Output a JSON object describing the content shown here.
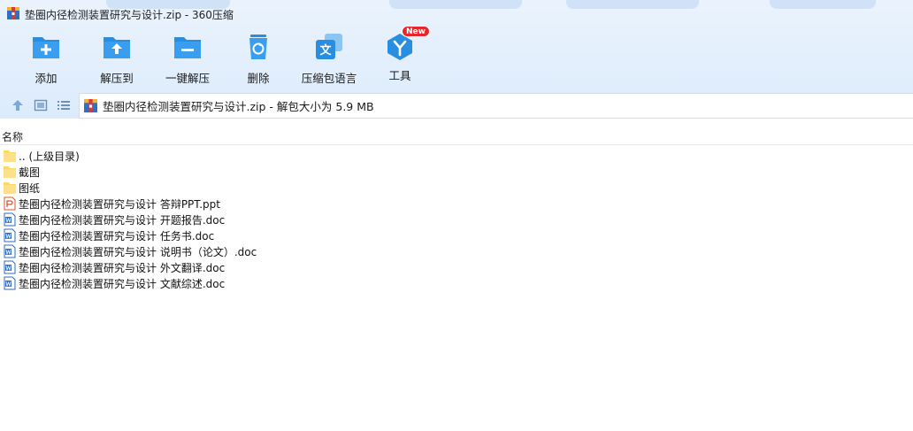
{
  "window": {
    "title": "垫圈内径检测装置研究与设计.zip - 360压缩"
  },
  "toolbar": {
    "add_label": "添加",
    "extract_to_label": "解压到",
    "one_click_extract_label": "一键解压",
    "delete_label": "删除",
    "language_label": "压缩包语言",
    "tools_label": "工具",
    "new_badge": "New"
  },
  "address": {
    "text": "垫圈内径检测装置研究与设计.zip - 解包大小为 5.9 MB"
  },
  "list": {
    "column_name": "名称",
    "items": [
      {
        "name": ".. (上级目录)",
        "type": "folder"
      },
      {
        "name": "截图",
        "type": "folder"
      },
      {
        "name": "图纸",
        "type": "folder"
      },
      {
        "name": "垫圈内径检测装置研究与设计 答辩PPT.ppt",
        "type": "ppt"
      },
      {
        "name": "垫圈内径检测装置研究与设计 开题报告.doc",
        "type": "doc"
      },
      {
        "name": "垫圈内径检测装置研究与设计 任务书.doc",
        "type": "doc"
      },
      {
        "name": "垫圈内径检测装置研究与设计 说明书（论文）.doc",
        "type": "doc"
      },
      {
        "name": "垫圈内径检测装置研究与设计 外文翻译.doc",
        "type": "doc"
      },
      {
        "name": "垫圈内径检测装置研究与设计 文献综述.doc",
        "type": "doc"
      }
    ]
  },
  "colors": {
    "accent": "#2a8ee0",
    "toolbar_bg": "#e3effc",
    "badge_red": "#e8262b",
    "folder_yellow": "#ffd767"
  }
}
